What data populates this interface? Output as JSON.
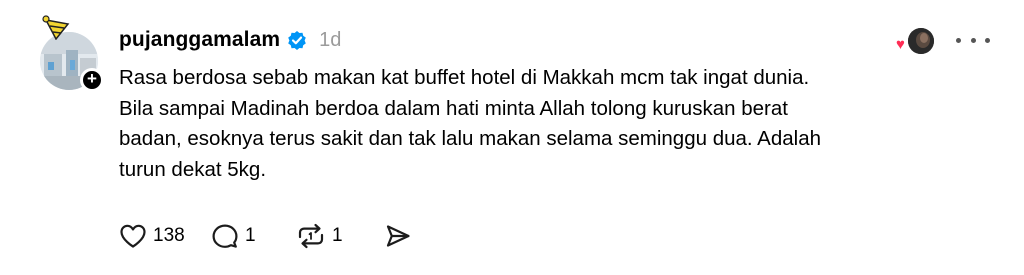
{
  "post": {
    "username": "pujanggamalam",
    "timestamp": "1d",
    "follow_badge": "+",
    "verified_icon": "verified-badge-icon",
    "body_lines": [
      "Rasa berdosa sebab makan kat buffet hotel di Makkah mcm tak ingat dunia.",
      "Bila sampai Madinah berdoa dalam hati minta Allah tolong kuruskan berat",
      "badan, esoknya terus sakit dan tak lalu makan selama seminggu dua. Adalah",
      "turun dekat 5kg."
    ],
    "actions": {
      "like_count": "138",
      "reply_count": "1",
      "repost_count": "1"
    },
    "icons": {
      "like": "heart-outline-icon",
      "reply": "speech-bubble-icon",
      "repost": "repost-arrows-icon",
      "share": "send-icon",
      "more": "more-dots-icon",
      "liker_heart": "heart-filled-icon"
    },
    "colors": {
      "verified": "#0095f6",
      "liker_heart": "#ff2d55",
      "timestamp": "#9b9b9b"
    }
  }
}
